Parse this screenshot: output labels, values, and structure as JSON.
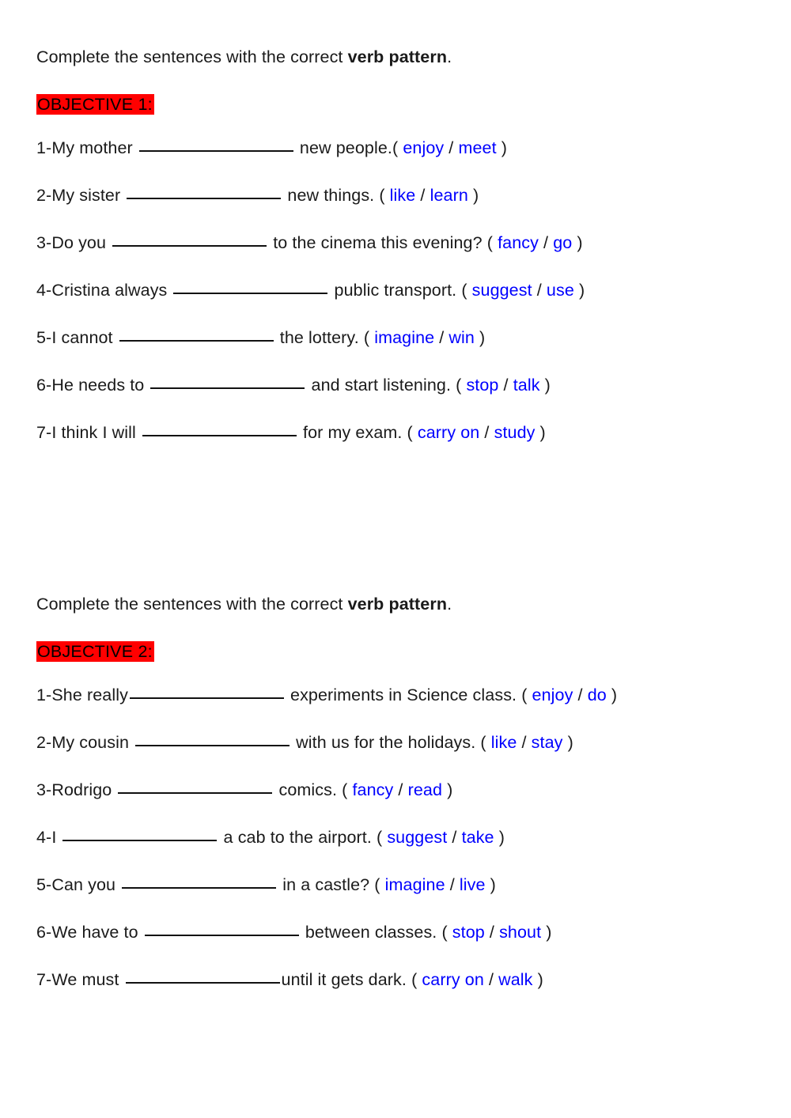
{
  "document": {
    "type": "worksheet",
    "topic": "verb patterns",
    "colors": {
      "highlight": "#ff0000",
      "option_verb": "#0000ff",
      "text": "#1a1a1a",
      "background": "#ffffff"
    }
  },
  "sections": [
    {
      "id": "section-1",
      "instruction_plain": "Complete the sentences with the correct ",
      "instruction_bold": "verb pattern",
      "instruction_end": ".",
      "objective_label": "OBJECTIVE 1:",
      "items": [
        {
          "number": "1-",
          "before": "My mother ",
          "after": " new people.",
          "open_paren": "( ",
          "option_a": "enjoy",
          "separator": " / ",
          "option_b": "meet",
          "close_paren": " )"
        },
        {
          "number": "2-",
          "before": "My sister ",
          "after": " new things. ",
          "open_paren": "( ",
          "option_a": "like",
          "separator": " / ",
          "option_b": "learn",
          "close_paren": " )"
        },
        {
          "number": "3-",
          "before": "Do you ",
          "after": " to the cinema this evening? ",
          "open_paren": "( ",
          "option_a": "fancy",
          "separator": " / ",
          "option_b": "go",
          "close_paren": " )"
        },
        {
          "number": "4-",
          "before": "Cristina always ",
          "after": " public transport. ",
          "open_paren": "( ",
          "option_a": "suggest",
          "separator": " / ",
          "option_b": "use",
          "close_paren": " )"
        },
        {
          "number": "5-",
          "before": "I cannot ",
          "after": " the lottery. ",
          "open_paren": "( ",
          "option_a": "imagine",
          "separator": " / ",
          "option_b": "win",
          "close_paren": " )"
        },
        {
          "number": "6-",
          "before": "He needs to ",
          "after": " and start listening. ",
          "open_paren": "( ",
          "option_a": "stop",
          "separator": " / ",
          "option_b": "talk",
          "close_paren": " )"
        },
        {
          "number": "7-",
          "before": "I think I will ",
          "after": " for my exam. ",
          "open_paren": "( ",
          "option_a": "carry on",
          "separator": " / ",
          "option_b": "study",
          "close_paren": " )"
        }
      ]
    },
    {
      "id": "section-2",
      "instruction_plain": "Complete the sentences with the correct ",
      "instruction_bold": "verb pattern",
      "instruction_end": ".",
      "objective_label": "OBJECTIVE 2:",
      "items": [
        {
          "number": "1-",
          "before": "She really",
          "after": " experiments in Science class. ",
          "open_paren": "( ",
          "option_a": "enjoy",
          "separator": " / ",
          "option_b": "do",
          "close_paren": " )"
        },
        {
          "number": "2-",
          "before": "My cousin ",
          "after": " with us for the holidays. ",
          "open_paren": "( ",
          "option_a": "like",
          "separator": " / ",
          "option_b": "stay",
          "close_paren": " )"
        },
        {
          "number": "3-",
          "before": "Rodrigo ",
          "after": " comics. ",
          "open_paren": "( ",
          "option_a": "fancy",
          "separator": " / ",
          "option_b": "read",
          "close_paren": " )"
        },
        {
          "number": "4-",
          "before": "I ",
          "after": " a cab to the airport. ",
          "open_paren": "( ",
          "option_a": "suggest",
          "separator": " / ",
          "option_b": "take",
          "close_paren": " )"
        },
        {
          "number": "5-",
          "before": "Can you ",
          "after": " in a castle? ",
          "open_paren": "( ",
          "option_a": "imagine",
          "separator": " / ",
          "option_b": "live",
          "close_paren": " )"
        },
        {
          "number": "6-",
          "before": "We have to ",
          "after": " between classes. ",
          "open_paren": "( ",
          "option_a": "stop",
          "separator": " / ",
          "option_b": "shout",
          "close_paren": " )"
        },
        {
          "number": "7-",
          "before": "We must ",
          "after": "until it gets dark. ",
          "open_paren": "( ",
          "option_a": "carry on",
          "separator": " / ",
          "option_b": "walk",
          "close_paren": " )"
        }
      ]
    }
  ]
}
